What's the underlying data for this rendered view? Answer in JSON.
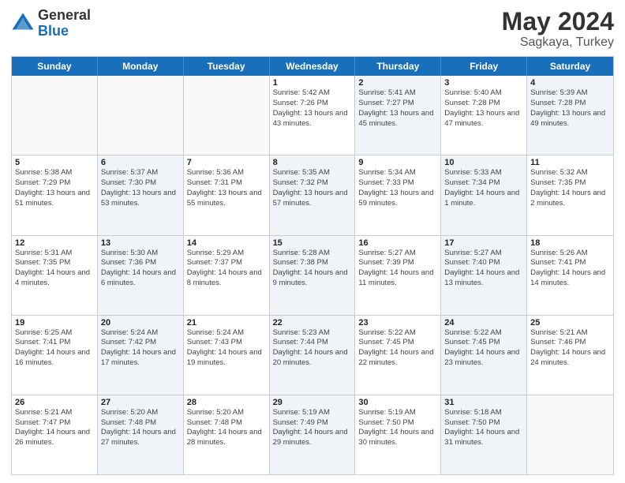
{
  "header": {
    "logo_general": "General",
    "logo_blue": "Blue",
    "title": "May 2024",
    "location": "Sagkaya, Turkey"
  },
  "days_of_week": [
    "Sunday",
    "Monday",
    "Tuesday",
    "Wednesday",
    "Thursday",
    "Friday",
    "Saturday"
  ],
  "weeks": [
    [
      {
        "day": "",
        "sunrise": "",
        "sunset": "",
        "daylight": "",
        "shaded": false,
        "empty": true
      },
      {
        "day": "",
        "sunrise": "",
        "sunset": "",
        "daylight": "",
        "shaded": false,
        "empty": true
      },
      {
        "day": "",
        "sunrise": "",
        "sunset": "",
        "daylight": "",
        "shaded": false,
        "empty": true
      },
      {
        "day": "1",
        "sunrise": "Sunrise: 5:42 AM",
        "sunset": "Sunset: 7:26 PM",
        "daylight": "Daylight: 13 hours and 43 minutes.",
        "shaded": false,
        "empty": false
      },
      {
        "day": "2",
        "sunrise": "Sunrise: 5:41 AM",
        "sunset": "Sunset: 7:27 PM",
        "daylight": "Daylight: 13 hours and 45 minutes.",
        "shaded": true,
        "empty": false
      },
      {
        "day": "3",
        "sunrise": "Sunrise: 5:40 AM",
        "sunset": "Sunset: 7:28 PM",
        "daylight": "Daylight: 13 hours and 47 minutes.",
        "shaded": false,
        "empty": false
      },
      {
        "day": "4",
        "sunrise": "Sunrise: 5:39 AM",
        "sunset": "Sunset: 7:28 PM",
        "daylight": "Daylight: 13 hours and 49 minutes.",
        "shaded": true,
        "empty": false
      }
    ],
    [
      {
        "day": "5",
        "sunrise": "Sunrise: 5:38 AM",
        "sunset": "Sunset: 7:29 PM",
        "daylight": "Daylight: 13 hours and 51 minutes.",
        "shaded": false,
        "empty": false
      },
      {
        "day": "6",
        "sunrise": "Sunrise: 5:37 AM",
        "sunset": "Sunset: 7:30 PM",
        "daylight": "Daylight: 13 hours and 53 minutes.",
        "shaded": true,
        "empty": false
      },
      {
        "day": "7",
        "sunrise": "Sunrise: 5:36 AM",
        "sunset": "Sunset: 7:31 PM",
        "daylight": "Daylight: 13 hours and 55 minutes.",
        "shaded": false,
        "empty": false
      },
      {
        "day": "8",
        "sunrise": "Sunrise: 5:35 AM",
        "sunset": "Sunset: 7:32 PM",
        "daylight": "Daylight: 13 hours and 57 minutes.",
        "shaded": true,
        "empty": false
      },
      {
        "day": "9",
        "sunrise": "Sunrise: 5:34 AM",
        "sunset": "Sunset: 7:33 PM",
        "daylight": "Daylight: 13 hours and 59 minutes.",
        "shaded": false,
        "empty": false
      },
      {
        "day": "10",
        "sunrise": "Sunrise: 5:33 AM",
        "sunset": "Sunset: 7:34 PM",
        "daylight": "Daylight: 14 hours and 1 minute.",
        "shaded": true,
        "empty": false
      },
      {
        "day": "11",
        "sunrise": "Sunrise: 5:32 AM",
        "sunset": "Sunset: 7:35 PM",
        "daylight": "Daylight: 14 hours and 2 minutes.",
        "shaded": false,
        "empty": false
      }
    ],
    [
      {
        "day": "12",
        "sunrise": "Sunrise: 5:31 AM",
        "sunset": "Sunset: 7:35 PM",
        "daylight": "Daylight: 14 hours and 4 minutes.",
        "shaded": false,
        "empty": false
      },
      {
        "day": "13",
        "sunrise": "Sunrise: 5:30 AM",
        "sunset": "Sunset: 7:36 PM",
        "daylight": "Daylight: 14 hours and 6 minutes.",
        "shaded": true,
        "empty": false
      },
      {
        "day": "14",
        "sunrise": "Sunrise: 5:29 AM",
        "sunset": "Sunset: 7:37 PM",
        "daylight": "Daylight: 14 hours and 8 minutes.",
        "shaded": false,
        "empty": false
      },
      {
        "day": "15",
        "sunrise": "Sunrise: 5:28 AM",
        "sunset": "Sunset: 7:38 PM",
        "daylight": "Daylight: 14 hours and 9 minutes.",
        "shaded": true,
        "empty": false
      },
      {
        "day": "16",
        "sunrise": "Sunrise: 5:27 AM",
        "sunset": "Sunset: 7:39 PM",
        "daylight": "Daylight: 14 hours and 11 minutes.",
        "shaded": false,
        "empty": false
      },
      {
        "day": "17",
        "sunrise": "Sunrise: 5:27 AM",
        "sunset": "Sunset: 7:40 PM",
        "daylight": "Daylight: 14 hours and 13 minutes.",
        "shaded": true,
        "empty": false
      },
      {
        "day": "18",
        "sunrise": "Sunrise: 5:26 AM",
        "sunset": "Sunset: 7:41 PM",
        "daylight": "Daylight: 14 hours and 14 minutes.",
        "shaded": false,
        "empty": false
      }
    ],
    [
      {
        "day": "19",
        "sunrise": "Sunrise: 5:25 AM",
        "sunset": "Sunset: 7:41 PM",
        "daylight": "Daylight: 14 hours and 16 minutes.",
        "shaded": false,
        "empty": false
      },
      {
        "day": "20",
        "sunrise": "Sunrise: 5:24 AM",
        "sunset": "Sunset: 7:42 PM",
        "daylight": "Daylight: 14 hours and 17 minutes.",
        "shaded": true,
        "empty": false
      },
      {
        "day": "21",
        "sunrise": "Sunrise: 5:24 AM",
        "sunset": "Sunset: 7:43 PM",
        "daylight": "Daylight: 14 hours and 19 minutes.",
        "shaded": false,
        "empty": false
      },
      {
        "day": "22",
        "sunrise": "Sunrise: 5:23 AM",
        "sunset": "Sunset: 7:44 PM",
        "daylight": "Daylight: 14 hours and 20 minutes.",
        "shaded": true,
        "empty": false
      },
      {
        "day": "23",
        "sunrise": "Sunrise: 5:22 AM",
        "sunset": "Sunset: 7:45 PM",
        "daylight": "Daylight: 14 hours and 22 minutes.",
        "shaded": false,
        "empty": false
      },
      {
        "day": "24",
        "sunrise": "Sunrise: 5:22 AM",
        "sunset": "Sunset: 7:45 PM",
        "daylight": "Daylight: 14 hours and 23 minutes.",
        "shaded": true,
        "empty": false
      },
      {
        "day": "25",
        "sunrise": "Sunrise: 5:21 AM",
        "sunset": "Sunset: 7:46 PM",
        "daylight": "Daylight: 14 hours and 24 minutes.",
        "shaded": false,
        "empty": false
      }
    ],
    [
      {
        "day": "26",
        "sunrise": "Sunrise: 5:21 AM",
        "sunset": "Sunset: 7:47 PM",
        "daylight": "Daylight: 14 hours and 26 minutes.",
        "shaded": false,
        "empty": false
      },
      {
        "day": "27",
        "sunrise": "Sunrise: 5:20 AM",
        "sunset": "Sunset: 7:48 PM",
        "daylight": "Daylight: 14 hours and 27 minutes.",
        "shaded": true,
        "empty": false
      },
      {
        "day": "28",
        "sunrise": "Sunrise: 5:20 AM",
        "sunset": "Sunset: 7:48 PM",
        "daylight": "Daylight: 14 hours and 28 minutes.",
        "shaded": false,
        "empty": false
      },
      {
        "day": "29",
        "sunrise": "Sunrise: 5:19 AM",
        "sunset": "Sunset: 7:49 PM",
        "daylight": "Daylight: 14 hours and 29 minutes.",
        "shaded": true,
        "empty": false
      },
      {
        "day": "30",
        "sunrise": "Sunrise: 5:19 AM",
        "sunset": "Sunset: 7:50 PM",
        "daylight": "Daylight: 14 hours and 30 minutes.",
        "shaded": false,
        "empty": false
      },
      {
        "day": "31",
        "sunrise": "Sunrise: 5:18 AM",
        "sunset": "Sunset: 7:50 PM",
        "daylight": "Daylight: 14 hours and 31 minutes.",
        "shaded": true,
        "empty": false
      },
      {
        "day": "",
        "sunrise": "",
        "sunset": "",
        "daylight": "",
        "shaded": false,
        "empty": true
      }
    ]
  ]
}
